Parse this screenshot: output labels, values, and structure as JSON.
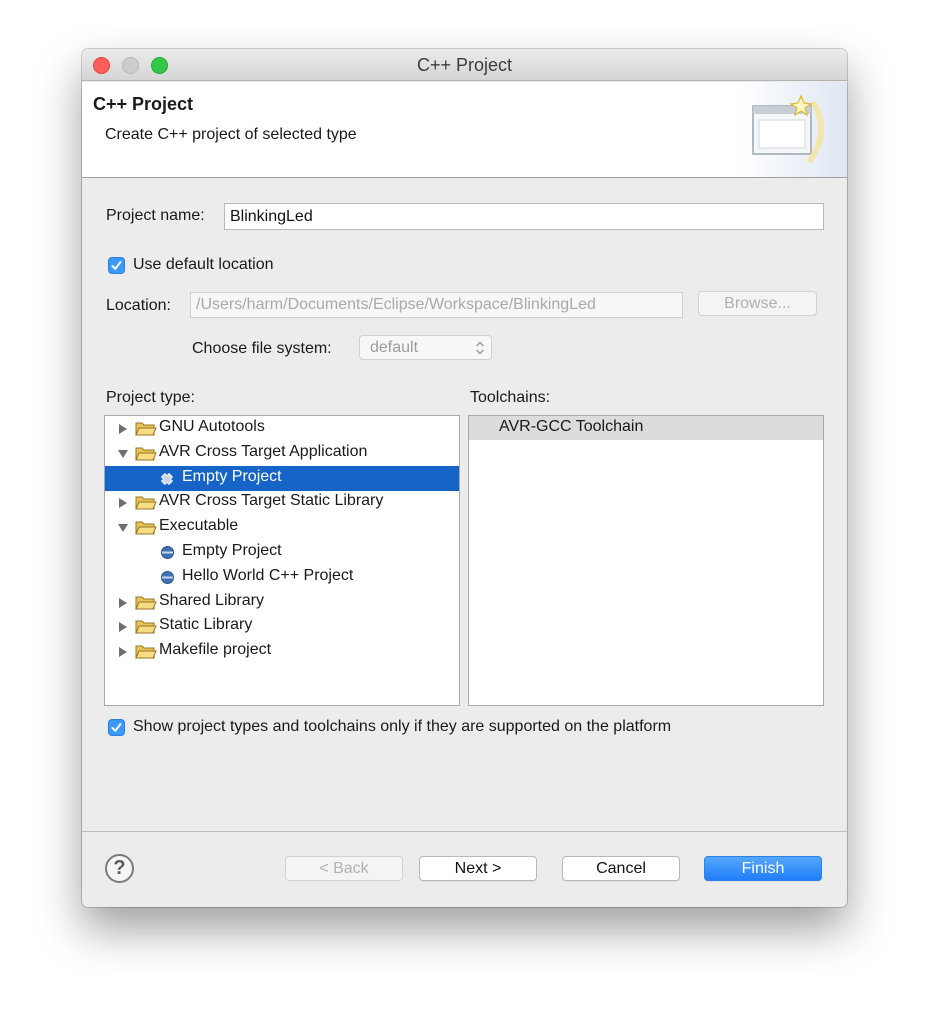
{
  "window": {
    "title": "C++ Project"
  },
  "header": {
    "title": "C++ Project",
    "description": "Create C++ project of selected type",
    "icon": "new-project-wizard-icon"
  },
  "form": {
    "project_name_label": "Project name:",
    "project_name_value": "BlinkingLed",
    "use_default_location_label": "Use default location",
    "use_default_location_checked": true,
    "location_label": "Location:",
    "location_value": "/Users/harm/Documents/Eclipse/Workspace/BlinkingLed",
    "browse_label": "Browse...",
    "file_system_label": "Choose file system:",
    "file_system_value": "default"
  },
  "project_type": {
    "label": "Project type:",
    "items": [
      {
        "label": "GNU Autotools",
        "kind": "folder",
        "expanded": false,
        "depth": 0
      },
      {
        "label": "AVR Cross Target Application",
        "kind": "folder",
        "expanded": true,
        "depth": 0
      },
      {
        "label": "Empty Project",
        "kind": "avr-template",
        "depth": 1,
        "selected": true
      },
      {
        "label": "AVR Cross Target Static Library",
        "kind": "folder",
        "expanded": false,
        "depth": 0
      },
      {
        "label": "Executable",
        "kind": "folder",
        "expanded": true,
        "depth": 0
      },
      {
        "label": "Empty Project",
        "kind": "template",
        "depth": 1
      },
      {
        "label": "Hello World C++ Project",
        "kind": "template",
        "depth": 1
      },
      {
        "label": "Shared Library",
        "kind": "folder",
        "expanded": false,
        "depth": 0
      },
      {
        "label": "Static Library",
        "kind": "folder",
        "expanded": false,
        "depth": 0
      },
      {
        "label": "Makefile project",
        "kind": "folder",
        "expanded": false,
        "depth": 0
      }
    ]
  },
  "toolchains": {
    "label": "Toolchains:",
    "items": [
      "AVR-GCC Toolchain"
    ]
  },
  "filter": {
    "label": "Show project types and toolchains only if they are supported on the platform",
    "checked": true
  },
  "buttons": {
    "help": "?",
    "back": "< Back",
    "next": "Next >",
    "cancel": "Cancel",
    "finish": "Finish"
  },
  "colors": {
    "accent": "#3b99fc",
    "selection": "#1764c8",
    "close": "#fc5f57",
    "maximize": "#34c84a"
  }
}
